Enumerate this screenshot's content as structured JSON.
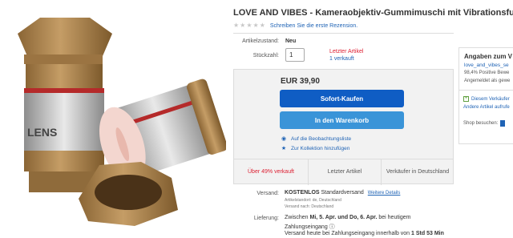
{
  "product": {
    "title": "LOVE AND VIBES - Kameraobjektiv-Gummimuschi mit Vibrationsfunktion",
    "rating_link": "Schreiben Sie die erste Rezension."
  },
  "details": {
    "condition_label": "Artikelzustand:",
    "condition_value": "Neu",
    "quantity_label": "Stückzahl:",
    "quantity_value": "1",
    "last_item": "Letzter Artikel",
    "sold": "1 verkauft"
  },
  "buy_box": {
    "price": "EUR 39,90",
    "buy_now": "Sofort-Kaufen",
    "add_to_cart": "In den Warenkorb",
    "watchlist": "Auf die Beobachtungsliste",
    "collection": "Zur Kollektion hinzufügen",
    "stats": [
      "Über 49% verkauft",
      "Letzter Artikel",
      "Verkäufer in Deutschland"
    ]
  },
  "shipping": {
    "label": "Versand:",
    "cost": "KOSTENLOS",
    "method": "Standardversand",
    "details_link": "Weitere Details",
    "location": "Artikelstandort: de, Deutschland",
    "ships_to": "Versand nach: Deutschland"
  },
  "delivery": {
    "label": "Lieferung:",
    "prefix": "Zwischen",
    "dates": "Mi, 5. Apr. und Do, 6. Apr.",
    "suffix": "bei heutigem",
    "line2": "Zahlungseingang",
    "line3_prefix": "Versand heute bei Zahlungseingang innerhalb von",
    "line3_time": "1 Std 53 Min"
  },
  "seller": {
    "title": "Angaben zum V",
    "name": "love_and_vibes_se",
    "rating": "98,4% Positive Bewe",
    "since": "Angemeldet als gewe",
    "save": "Diesem Verkäufer",
    "other_items": "Andere Artikel aufrufe",
    "shop": "Shop besuchen:"
  },
  "colors": {
    "accent_blue": "#0f5dc4",
    "cart_blue": "#3a94d8",
    "link_blue": "#1f63b5",
    "alert_red": "#dd1e31"
  },
  "icons": {
    "watch": "eye-icon",
    "collection": "star-icon",
    "save": "plus-icon",
    "shop": "shop-icon"
  }
}
